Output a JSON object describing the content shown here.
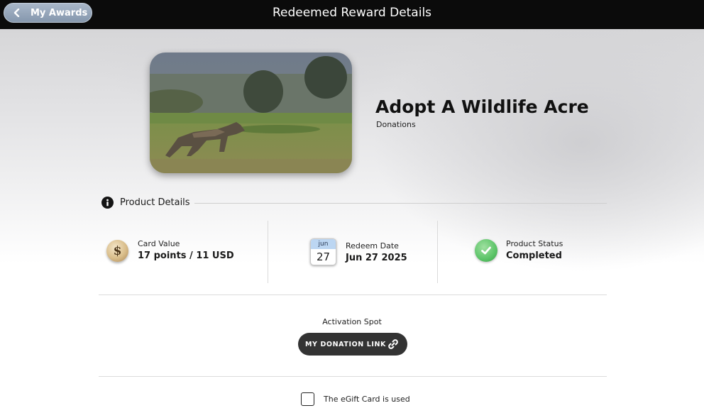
{
  "header": {
    "back_label": "My Awards",
    "title": "Redeemed Reward Details"
  },
  "product": {
    "name": "Adopt A Wildlife Acre",
    "category": "Donations"
  },
  "details": {
    "section_title": "Product Details",
    "card_value_label": "Card Value",
    "card_value": "17 points / 11 USD",
    "redeem_date_label": "Redeem Date",
    "redeem_date": "Jun 27 2025",
    "calendar_month": "jun",
    "calendar_day": "27",
    "status_label": "Product Status",
    "status_value": "Completed",
    "coin_symbol": "$"
  },
  "activation": {
    "label": "Activation Spot",
    "button_label": "MY DONATION LINK"
  },
  "used": {
    "label": "The eGift Card is used",
    "checked": false
  },
  "icons": {
    "back": "chevron-left-icon",
    "info": "info-icon",
    "coin": "dollar-coin-icon",
    "calendar": "calendar-icon",
    "status": "check-circle-icon",
    "link": "link-icon"
  },
  "colors": {
    "topbar": "#0b0b0b",
    "back_button": "#8f9fb5",
    "status_green": "#5cc468",
    "button_dark": "#333333"
  }
}
